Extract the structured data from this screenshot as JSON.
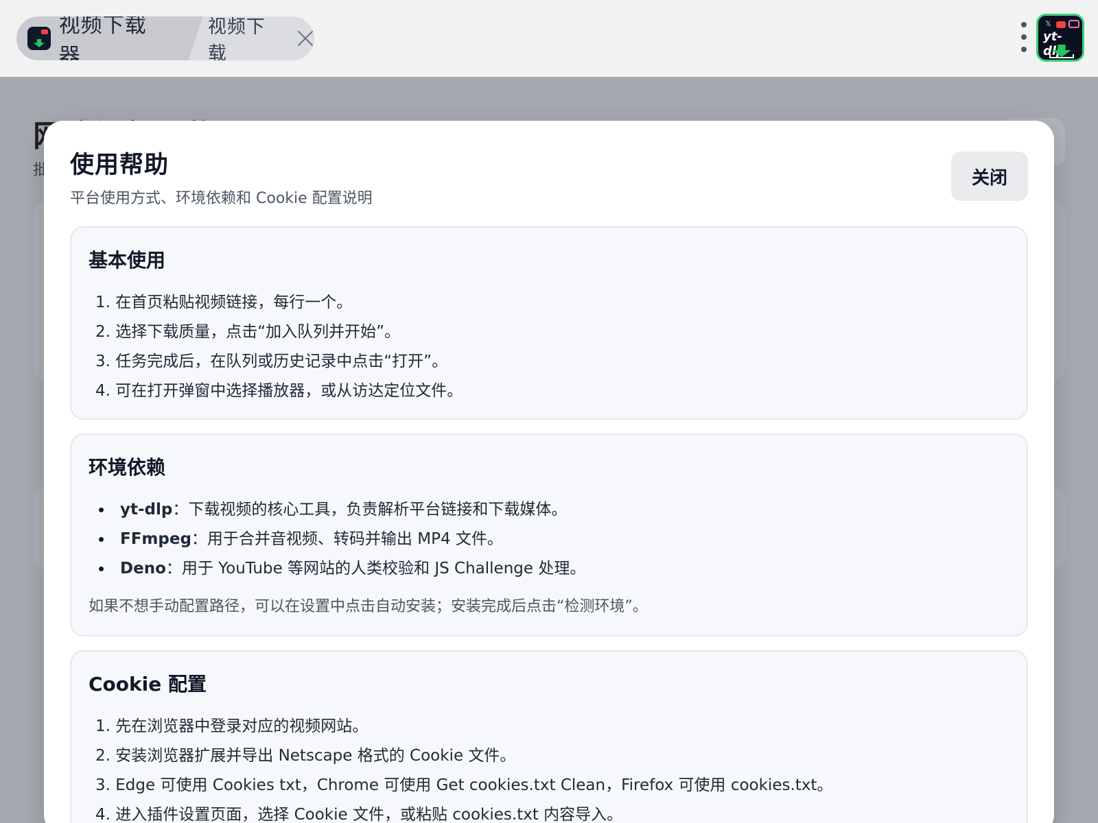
{
  "tabs": {
    "active_label": "视频下载器",
    "second_label": "视频下载"
  },
  "app_logo": {
    "text": "yt-dlp"
  },
  "background": {
    "title": "网络视频下载",
    "subtitle": "批"
  },
  "modal": {
    "title": "使用帮助",
    "subtitle": "平台使用方式、环境依赖和 Cookie 配置说明",
    "close_label": "关闭",
    "sections": [
      {
        "title": "基本使用",
        "items": [
          "在首页粘贴视频链接，每行一个。",
          "选择下载质量，点击“加入队列并开始”。",
          "任务完成后，在队列或历史记录中点击“打开”。",
          "可在打开弹窗中选择播放器，或从访达定位文件。"
        ]
      },
      {
        "title": "环境依赖",
        "items": [
          {
            "name": "yt-dlp",
            "desc": "：下载视频的核心工具，负责解析平台链接和下载媒体。"
          },
          {
            "name": "FFmpeg",
            "desc": "：用于合并音视频、转码并输出 MP4 文件。"
          },
          {
            "name": "Deno",
            "desc": "：用于 YouTube 等网站的人类校验和 JS Challenge 处理。"
          }
        ],
        "note": "如果不想手动配置路径，可以在设置中点击自动安装；安装完成后点击“检测环境”。"
      },
      {
        "title": "Cookie 配置",
        "items": [
          "先在浏览器中登录对应的视频网站。",
          "安装浏览器扩展并导出 Netscape 格式的 Cookie 文件。",
          "Edge 可使用 Cookies txt，Chrome 可使用 Get cookies.txt Clean，Firefox 可使用 cookies.txt。",
          "进入插件设置页面，选择 Cookie 文件，或粘贴 cookies.txt 内容导入。"
        ]
      }
    ]
  },
  "icons": {
    "tab_icon": "yt-dlp-app-icon",
    "tab_close": "close-icon",
    "menu": "more-vertical-icon"
  },
  "colors": {
    "accent_green": "#22c55e",
    "overlay": "#a7a9b1"
  }
}
